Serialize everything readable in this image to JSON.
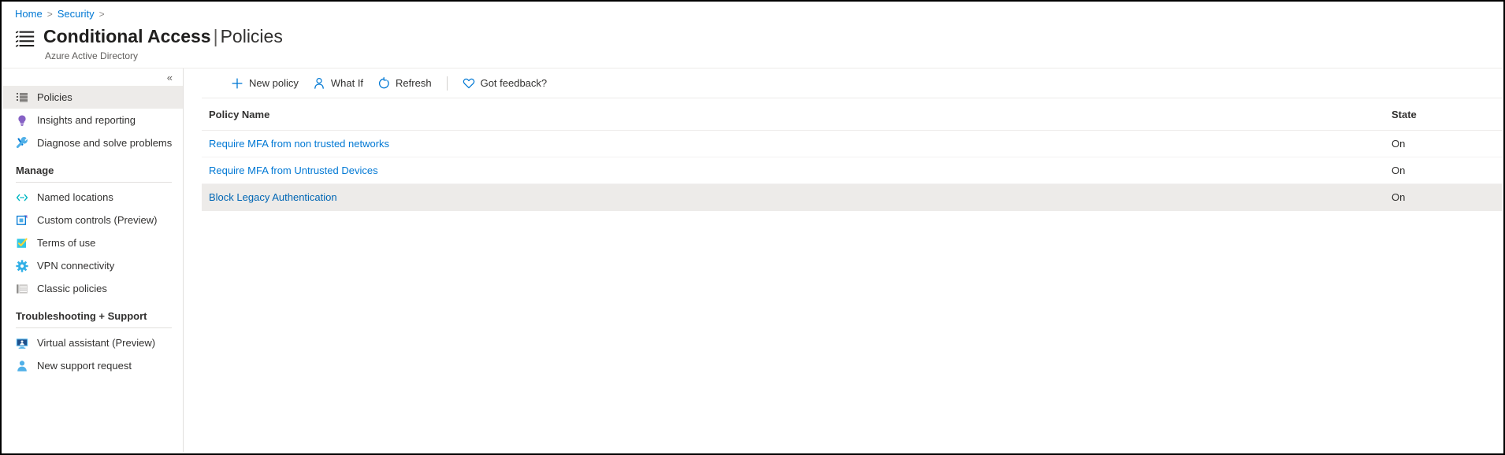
{
  "breadcrumb": {
    "items": [
      "Home",
      "Security"
    ],
    "separator": ">"
  },
  "header": {
    "title": "Conditional Access",
    "separator": "|",
    "subsection": "Policies",
    "subtitle": "Azure Active Directory",
    "icon": "list-bullet-icon"
  },
  "sidebar": {
    "collapse_label": "«",
    "items": [
      {
        "label": "Policies",
        "icon": "list-icon",
        "selected": true
      },
      {
        "label": "Insights and reporting",
        "icon": "lightbulb-icon",
        "selected": false
      },
      {
        "label": "Diagnose and solve problems",
        "icon": "wrench-icon",
        "selected": false
      }
    ],
    "groups": [
      {
        "title": "Manage",
        "items": [
          {
            "label": "Named locations",
            "icon": "code-brackets-icon"
          },
          {
            "label": "Custom controls (Preview)",
            "icon": "square-overlay-icon"
          },
          {
            "label": "Terms of use",
            "icon": "checkbox-checked-icon"
          },
          {
            "label": "VPN connectivity",
            "icon": "gear-icon"
          },
          {
            "label": "Classic policies",
            "icon": "list-lines-icon"
          }
        ]
      },
      {
        "title": "Troubleshooting + Support",
        "items": [
          {
            "label": "Virtual assistant (Preview)",
            "icon": "monitor-person-icon"
          },
          {
            "label": "New support request",
            "icon": "person-icon"
          }
        ]
      }
    ]
  },
  "toolbar": {
    "commands": [
      {
        "label": "New policy",
        "icon": "plus-icon"
      },
      {
        "label": "What If",
        "icon": "person-icon"
      },
      {
        "label": "Refresh",
        "icon": "refresh-icon"
      }
    ],
    "feedback": {
      "label": "Got feedback?",
      "icon": "heart-icon"
    }
  },
  "table": {
    "columns": [
      "Policy Name",
      "State"
    ],
    "rows": [
      {
        "name": "Require MFA from non trusted networks",
        "state": "On"
      },
      {
        "name": "Require MFA from Untrusted Devices",
        "state": "On"
      },
      {
        "name": "Block Legacy Authentication",
        "state": "On"
      }
    ]
  },
  "colors": {
    "accent": "#0078d4",
    "selection": "#edebe9",
    "purple": "#8661c5",
    "teal": "#00b7c3",
    "yellow": "#ffd633"
  }
}
